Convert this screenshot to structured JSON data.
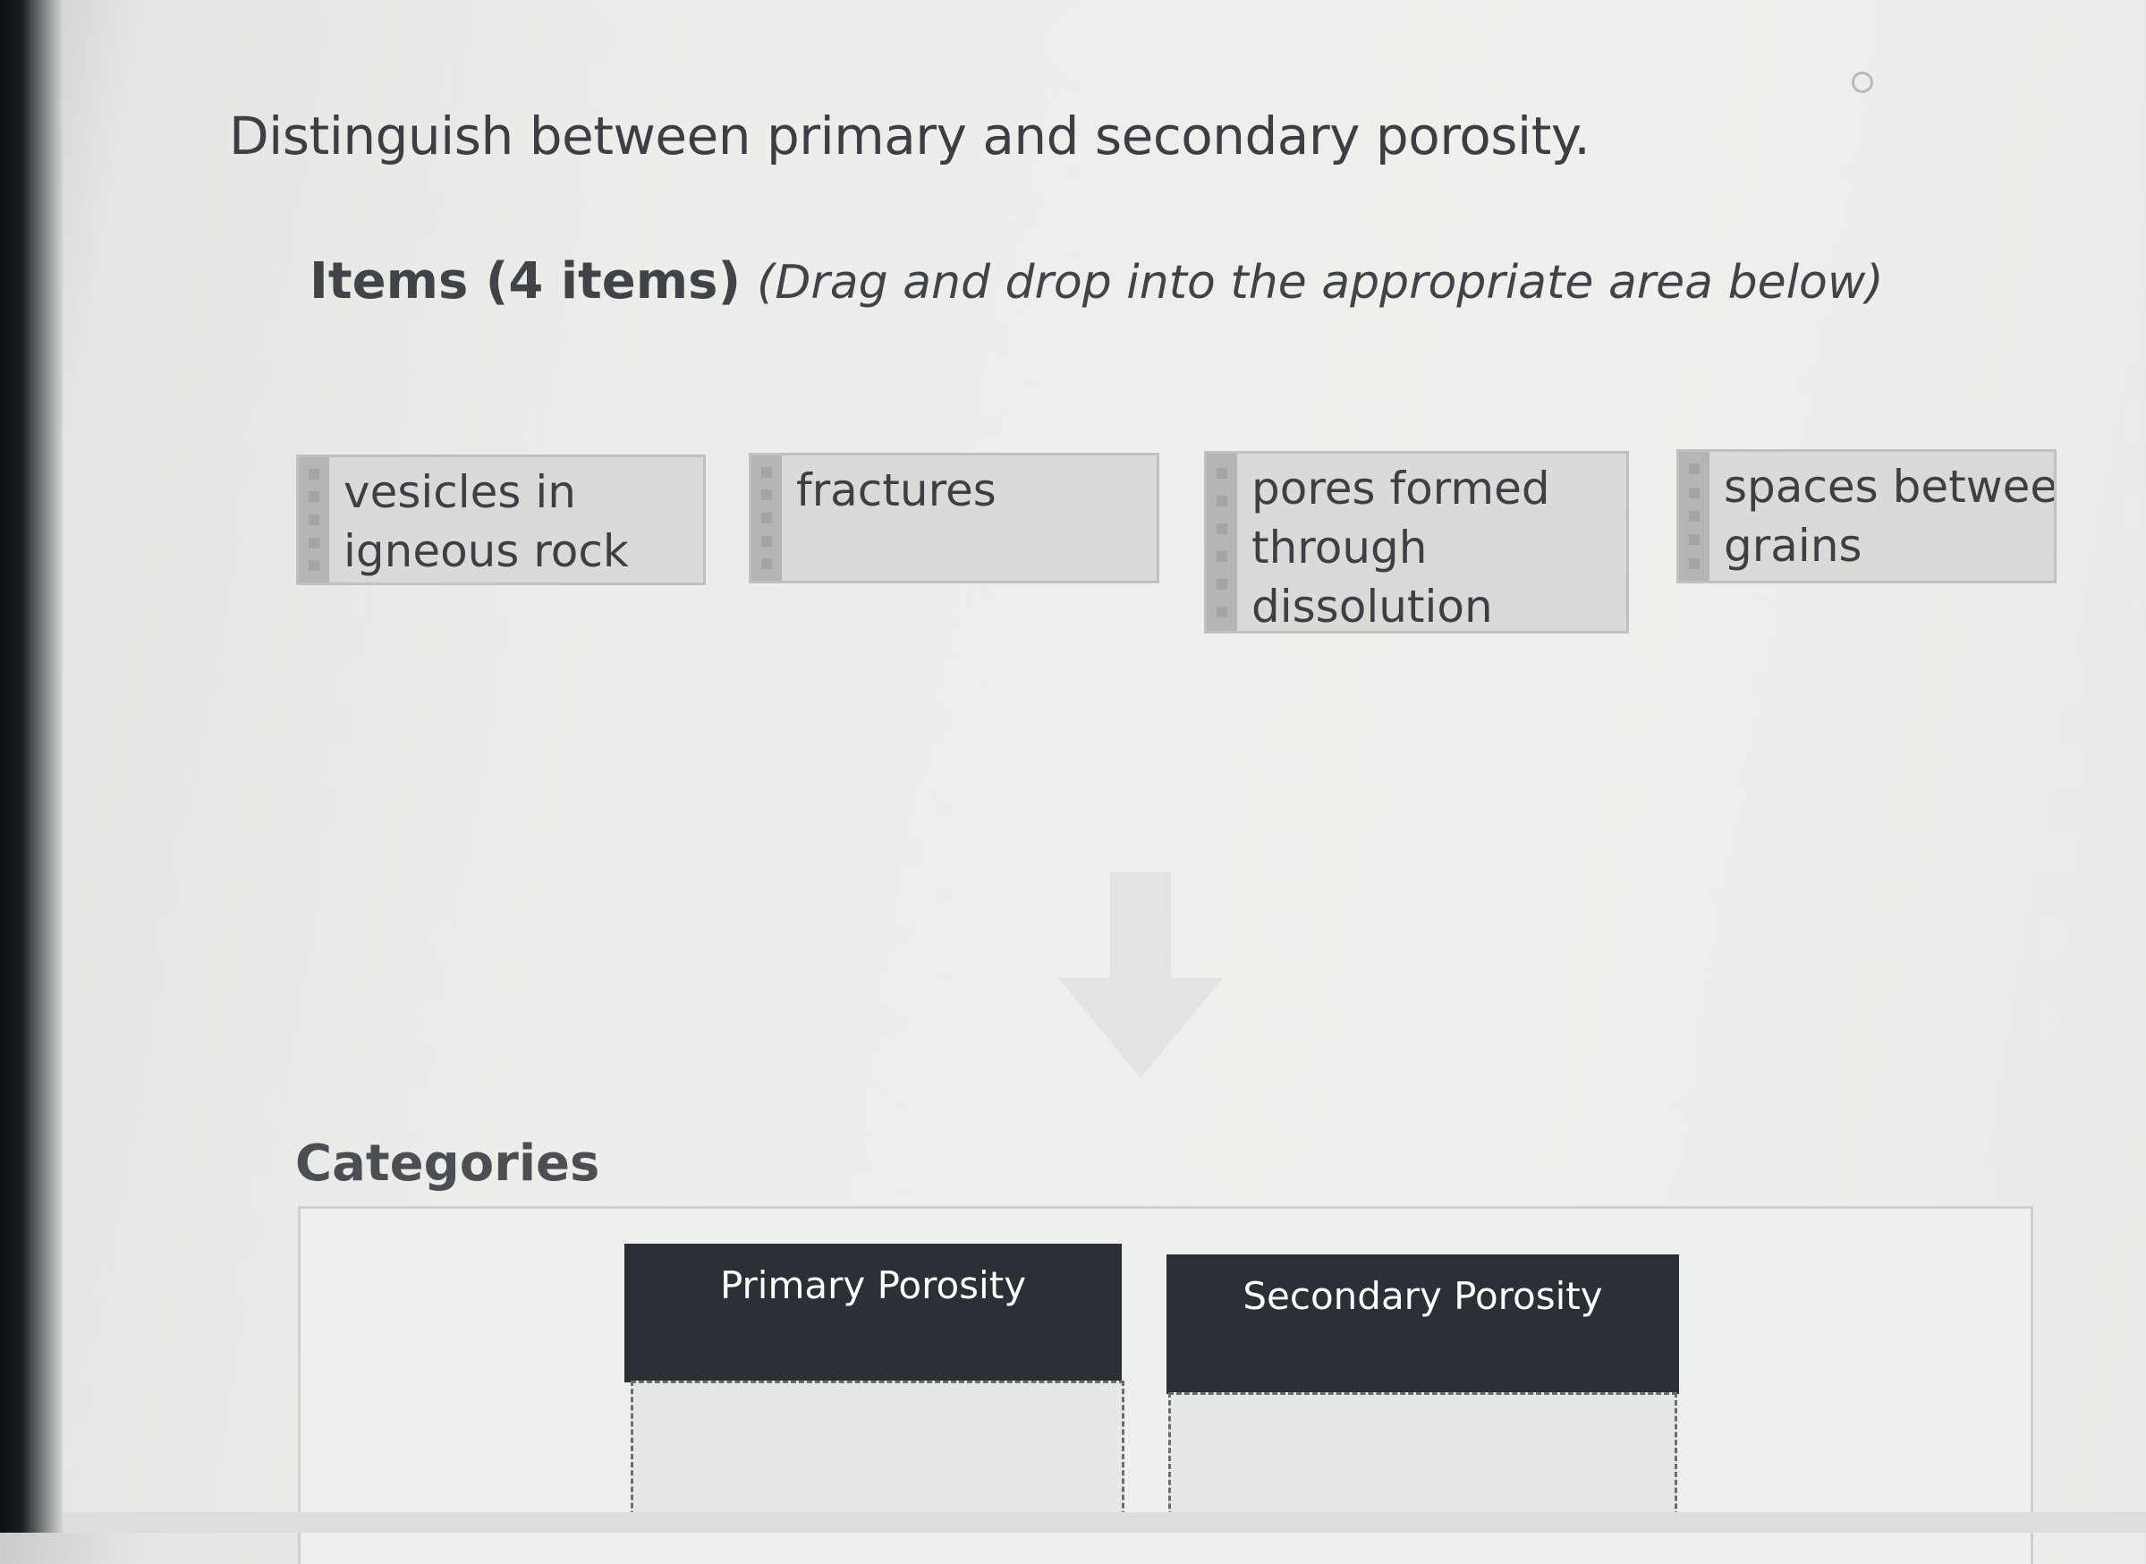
{
  "question": "Distinguish between primary and secondary porosity.",
  "items_section": {
    "heading": "Items (4 items)",
    "instruction": "(Drag and drop into the appropriate area below)"
  },
  "items": [
    {
      "label": "vesicles in\nigneous rock"
    },
    {
      "label": "fractures"
    },
    {
      "label": "pores formed\nthrough\ndissolution"
    },
    {
      "label": "spaces between\ngrains"
    }
  ],
  "categories_section": {
    "title": "Categories"
  },
  "categories": [
    {
      "label": "Primary Porosity"
    },
    {
      "label": "Secondary Porosity"
    }
  ],
  "colors": {
    "category_header_bg": "#2b3037",
    "item_bg": "#d9dbd8",
    "page_bg": "#eceeeb"
  },
  "icons": {
    "drop_arrow": "arrow-down-icon",
    "item_grip": "drag-handle-icon"
  }
}
